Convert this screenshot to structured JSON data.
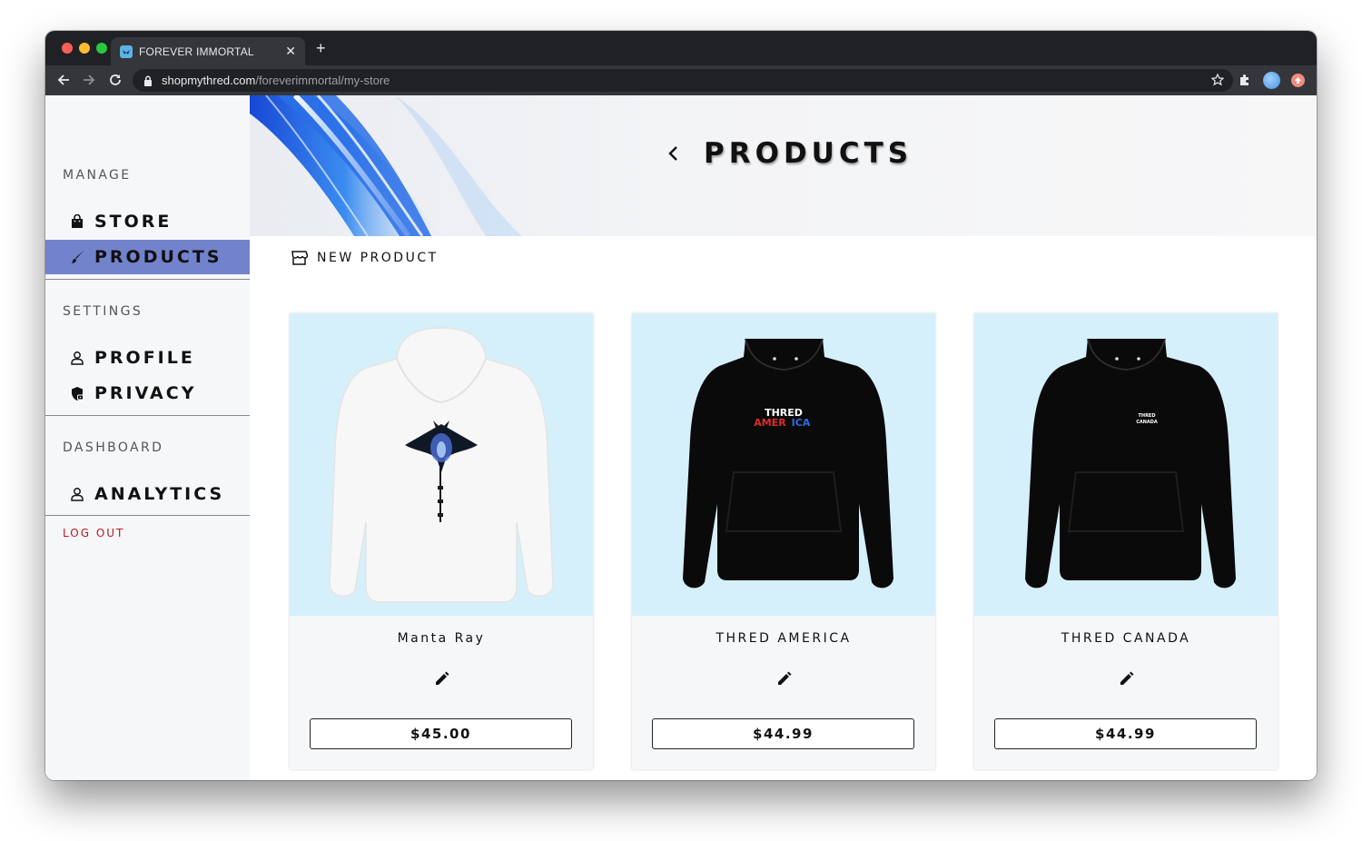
{
  "browser": {
    "tab_title": "FOREVER IMMORTAL",
    "new_tab_glyph": "+",
    "close_glyph": "✕",
    "url_host": "shopmythred.com",
    "url_path": "/foreverimmortal/my-store"
  },
  "sidebar": {
    "sections": [
      {
        "heading": "MANAGE",
        "items": [
          {
            "label": "STORE",
            "icon": "bag-icon",
            "active": false
          },
          {
            "label": "PRODUCTS",
            "icon": "brush-icon",
            "active": true
          }
        ]
      },
      {
        "heading": "SETTINGS",
        "items": [
          {
            "label": "PROFILE",
            "icon": "user-icon",
            "active": false
          },
          {
            "label": "PRIVACY",
            "icon": "shield-lock-icon",
            "active": false
          }
        ]
      },
      {
        "heading": "DASHBOARD",
        "items": [
          {
            "label": "ANALYTICS",
            "icon": "user-icon",
            "active": false
          }
        ]
      }
    ],
    "logout_label": "LOG OUT",
    "active_color": "#7282cc",
    "logout_color": "#c0141e"
  },
  "main": {
    "heading": "PRODUCTS",
    "new_product_label": "NEW PRODUCT",
    "products": [
      {
        "name": "Manta Ray",
        "price": "$45.00",
        "hoodie_color": "white",
        "print": "manta-ray-graphic"
      },
      {
        "name": "THRED AMERICA",
        "price": "$44.99",
        "hoodie_color": "black",
        "print": "THRED AMERICA"
      },
      {
        "name": "THRED CANADA",
        "price": "$44.99",
        "hoodie_color": "black",
        "print": "THRED CANADA"
      }
    ],
    "card_image_bg": "#d6f0fb"
  }
}
